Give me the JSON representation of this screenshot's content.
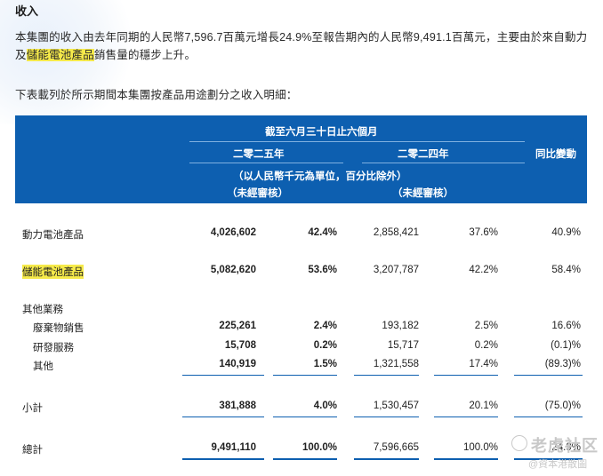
{
  "section_title": "收入",
  "paragraph": {
    "part1": "本集團的收入由去年同期的人民幣7,596.7百萬元增長24.9%至報告期內的人民幣9,491.1百萬元，主要由於來自動力及",
    "highlight": "儲能電池產品",
    "part2": "銷售量的穩步上升。"
  },
  "intro": "下表載列於所示期間本集團按產品用途劃分之收入明細：",
  "header": {
    "period": "截至六月三十日止六個月",
    "year_2025": "二零二五年",
    "year_2024": "二零二四年",
    "yoy": "同比變動",
    "unit": "（以人民幣千元為單位，百分比除外）",
    "unaudited_2025": "（未經審核）",
    "unaudited_2024": "（未經審核）"
  },
  "rows": [
    {
      "label": "動力電池產品",
      "rev_2025": "4,026,602",
      "pct_2025": "42.4%",
      "rev_2024": "2,858,421",
      "pct_2024": "37.6%",
      "yoy": "40.9%"
    },
    {
      "label": "儲能電池產品",
      "rev_2025": "5,082,620",
      "pct_2025": "53.6%",
      "rev_2024": "3,207,787",
      "pct_2024": "42.2%",
      "yoy": "58.4%"
    },
    {
      "label": "其他業務"
    },
    {
      "label": "廢棄物銷售",
      "rev_2025": "225,261",
      "pct_2025": "2.4%",
      "rev_2024": "193,182",
      "pct_2024": "2.5%",
      "yoy": "16.6%"
    },
    {
      "label": "研發服務",
      "rev_2025": "15,708",
      "pct_2025": "0.2%",
      "rev_2024": "15,717",
      "pct_2024": "0.2%",
      "yoy": "(0.1)%"
    },
    {
      "label": "其他",
      "rev_2025": "140,919",
      "pct_2025": "1.5%",
      "rev_2024": "1,321,558",
      "pct_2024": "17.4%",
      "yoy": "(89.3)%"
    },
    {
      "label": "小計",
      "rev_2025": "381,888",
      "pct_2025": "4.0%",
      "rev_2024": "1,530,457",
      "pct_2024": "20.1%",
      "yoy": "(75.0)%"
    },
    {
      "label": "總計",
      "rev_2025": "9,491,110",
      "pct_2025": "100.0%",
      "rev_2024": "7,596,665",
      "pct_2024": "100.0%",
      "yoy": "24.9%"
    }
  ],
  "watermark": {
    "main": "老虎社区",
    "sub": "@資本港散圖"
  },
  "colors": {
    "header_bg": "#0d5fb0",
    "highlight": "#f6ea4a"
  }
}
